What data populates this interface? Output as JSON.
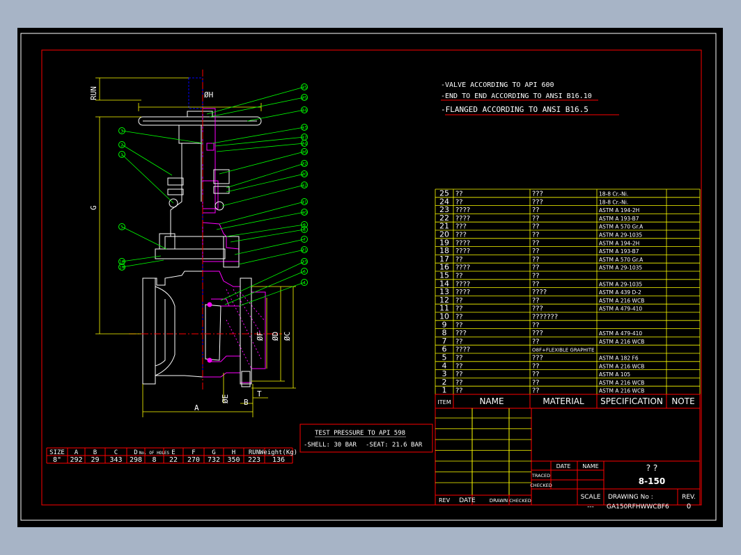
{
  "notes": [
    "-VALVE ACCORDING TO API 600",
    "-END TO END ACCORDING TO ANSI B16.10",
    "-FLANGED ACCORDING TO ANSI B16.5"
  ],
  "dimension_labels": {
    "run": "RUN",
    "g": "G",
    "h": "ØH",
    "f": "ØF",
    "d": "ØD",
    "c": "ØC",
    "e": "ØE",
    "b": "B",
    "a": "A",
    "t": "T"
  },
  "balloons": [
    "15",
    "25",
    "14",
    "13",
    "17",
    "24",
    "16",
    "22",
    "20",
    "12",
    "11",
    "10",
    "9",
    "8",
    "7",
    "21",
    "23",
    "6",
    "4",
    "3",
    "2",
    "1",
    "5",
    "18",
    "19"
  ],
  "parts": [
    {
      "item": "25",
      "name": "??",
      "material": "???",
      "spec": "18-8 Cr.-Ni."
    },
    {
      "item": "24",
      "name": "??",
      "material": "???",
      "spec": "18-8 Cr.-Ni."
    },
    {
      "item": "23",
      "name": "????",
      "material": "??",
      "spec": "ASTM A 194-2H"
    },
    {
      "item": "22",
      "name": "????",
      "material": "??",
      "spec": "ASTM A 193-B7"
    },
    {
      "item": "21",
      "name": "???",
      "material": "??",
      "spec": "ASTM A 570 Gr.A"
    },
    {
      "item": "20",
      "name": "???",
      "material": "??",
      "spec": "ASTM A 29-1035"
    },
    {
      "item": "19",
      "name": "????",
      "material": "??",
      "spec": "ASTM A 194-2H"
    },
    {
      "item": "18",
      "name": "????",
      "material": "??",
      "spec": "ASTM A 193-B7"
    },
    {
      "item": "17",
      "name": "??",
      "material": "??",
      "spec": "ASTM A 570 Gr.A"
    },
    {
      "item": "16",
      "name": "????",
      "material": "??",
      "spec": "ASTM A 29-1035"
    },
    {
      "item": "15",
      "name": "??",
      "material": "??",
      "spec": ""
    },
    {
      "item": "14",
      "name": "????",
      "material": "??",
      "spec": "ASTM A 29-1035"
    },
    {
      "item": "13",
      "name": "????",
      "material": "????",
      "spec": "ASTM A 439 D-2"
    },
    {
      "item": "12",
      "name": "??",
      "material": "??",
      "spec": "ASTM A 216 WCB"
    },
    {
      "item": "11",
      "name": "??",
      "material": "???",
      "spec": "ASTM A 479-410"
    },
    {
      "item": "10",
      "name": "??",
      "material": "???????",
      "spec": ""
    },
    {
      "item": "9",
      "name": "??",
      "material": "??",
      "spec": ""
    },
    {
      "item": "8",
      "name": "???",
      "material": "???",
      "spec": "ASTM A 479-410"
    },
    {
      "item": "7",
      "name": "??",
      "material": "??",
      "spec": "ASTM A 216 WCB"
    },
    {
      "item": "6",
      "name": "????",
      "material": "O8F+FLEXIBLE GRAPHITE",
      "spec": ""
    },
    {
      "item": "5",
      "name": "??",
      "material": "???",
      "spec": "ASTM A 182 F6"
    },
    {
      "item": "4",
      "name": "??",
      "material": "??",
      "spec": "ASTM A 216 WCB"
    },
    {
      "item": "3",
      "name": "??",
      "material": "??",
      "spec": "ASTM A 105"
    },
    {
      "item": "2",
      "name": "??",
      "material": "??",
      "spec": "ASTM A 216 WCB"
    },
    {
      "item": "1",
      "name": "??",
      "material": "??",
      "spec": "ASTM A 216 WCB"
    }
  ],
  "parts_header": {
    "item": "ITEM",
    "name": "NAME",
    "material": "MATERIAL",
    "spec": "SPECIFICATION",
    "note": "NOTE"
  },
  "test_pressure": {
    "title": "TEST PRESSURE TO API 598",
    "shell": "-SHELL: 30 BAR",
    "seat": "-SEAT: 21.6 BAR"
  },
  "dim_table": {
    "headers": [
      "SIZE",
      "A",
      "B",
      "C",
      "D",
      "No. OF HOLES",
      "E",
      "F",
      "G",
      "H",
      "RUN",
      "Weight(Kg)"
    ],
    "values": [
      "8\"",
      "292",
      "29",
      "343",
      "298",
      "8",
      "22",
      "270",
      "732",
      "350",
      "223",
      "136"
    ]
  },
  "title_block": {
    "date": "DATE",
    "name": "NAME",
    "traced": "TRACED",
    "checked": "CHECKED",
    "title_cn": "?   ?",
    "model": "8-150",
    "scale_label": "SCALE",
    "scale_value": "---",
    "drawing_label": "DRAWING No :",
    "drawing_no": "GA150RFHWWCBF6",
    "rev_label": "REV.",
    "rev_value": "0",
    "rev_cols": [
      "REV",
      "DATE",
      "DRAWN",
      "CHECKED"
    ]
  },
  "colors": {
    "frame": "#ff0000",
    "table": "#ffff00",
    "leader": "#00ff00",
    "dim": "#ffff00",
    "body": "#ff00ff",
    "stem": "#0000ff",
    "outline": "#ffffff"
  }
}
